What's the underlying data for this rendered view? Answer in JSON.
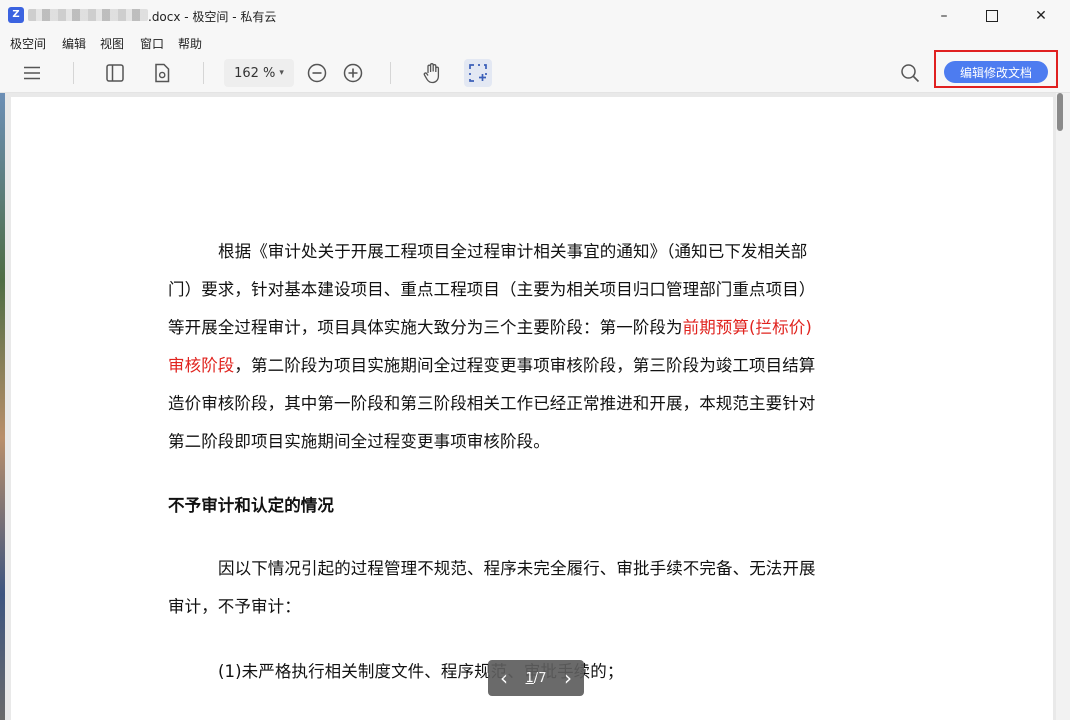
{
  "window": {
    "title_suffix": ".docx - 极空间 - 私有云",
    "minimize": "–",
    "close": "✕"
  },
  "menu": [
    "极空间",
    "编辑",
    "视图",
    "窗口",
    "帮助"
  ],
  "toolbar": {
    "zoom_value": "162 %",
    "edit_button": "编辑修改文档"
  },
  "document": {
    "p1_l1": "根据《审计处关于开展工程项目全过程审计相关事宜的通知》（通知已下发相关部",
    "p1_l2": "门）要求，针对基本建设项目、重点工程项目（主要为相关项目归口管理部门重点项目）",
    "p1_l3_a": "等开展全过程审计，项目具体实施大致分为三个主要阶段：第一阶段为",
    "p1_l3_red": "前期预算(拦标价)",
    "p1_l4_red": "审核阶段",
    "p1_l4_b": "，第二阶段为项目实施期间全过程变更事项审核阶段，第三阶段为竣工项目结算",
    "p1_l5": "造价审核阶段，其中第一阶段和第三阶段相关工作已经正常推进和开展，本规范主要针对",
    "p1_l6": "第二阶段即项目实施期间全过程变更事项审核阶段。",
    "heading": "不予审计和认定的情况",
    "p2_l1": "因以下情况引起的过程管理不规范、程序未完全履行、审批手续不完备、无法开展",
    "p2_l2": "审计，不予审计：",
    "p3_l1": "(1)未严格执行相关制度文件、程序规范、审批手续的；"
  },
  "pager": {
    "prev": "‹",
    "current": "1",
    "separator": "/",
    "total": "7",
    "next": "›"
  },
  "colors": {
    "accent": "#4d7cf0",
    "highlight_red": "#e0241f",
    "annotation_box": "#e02020"
  }
}
